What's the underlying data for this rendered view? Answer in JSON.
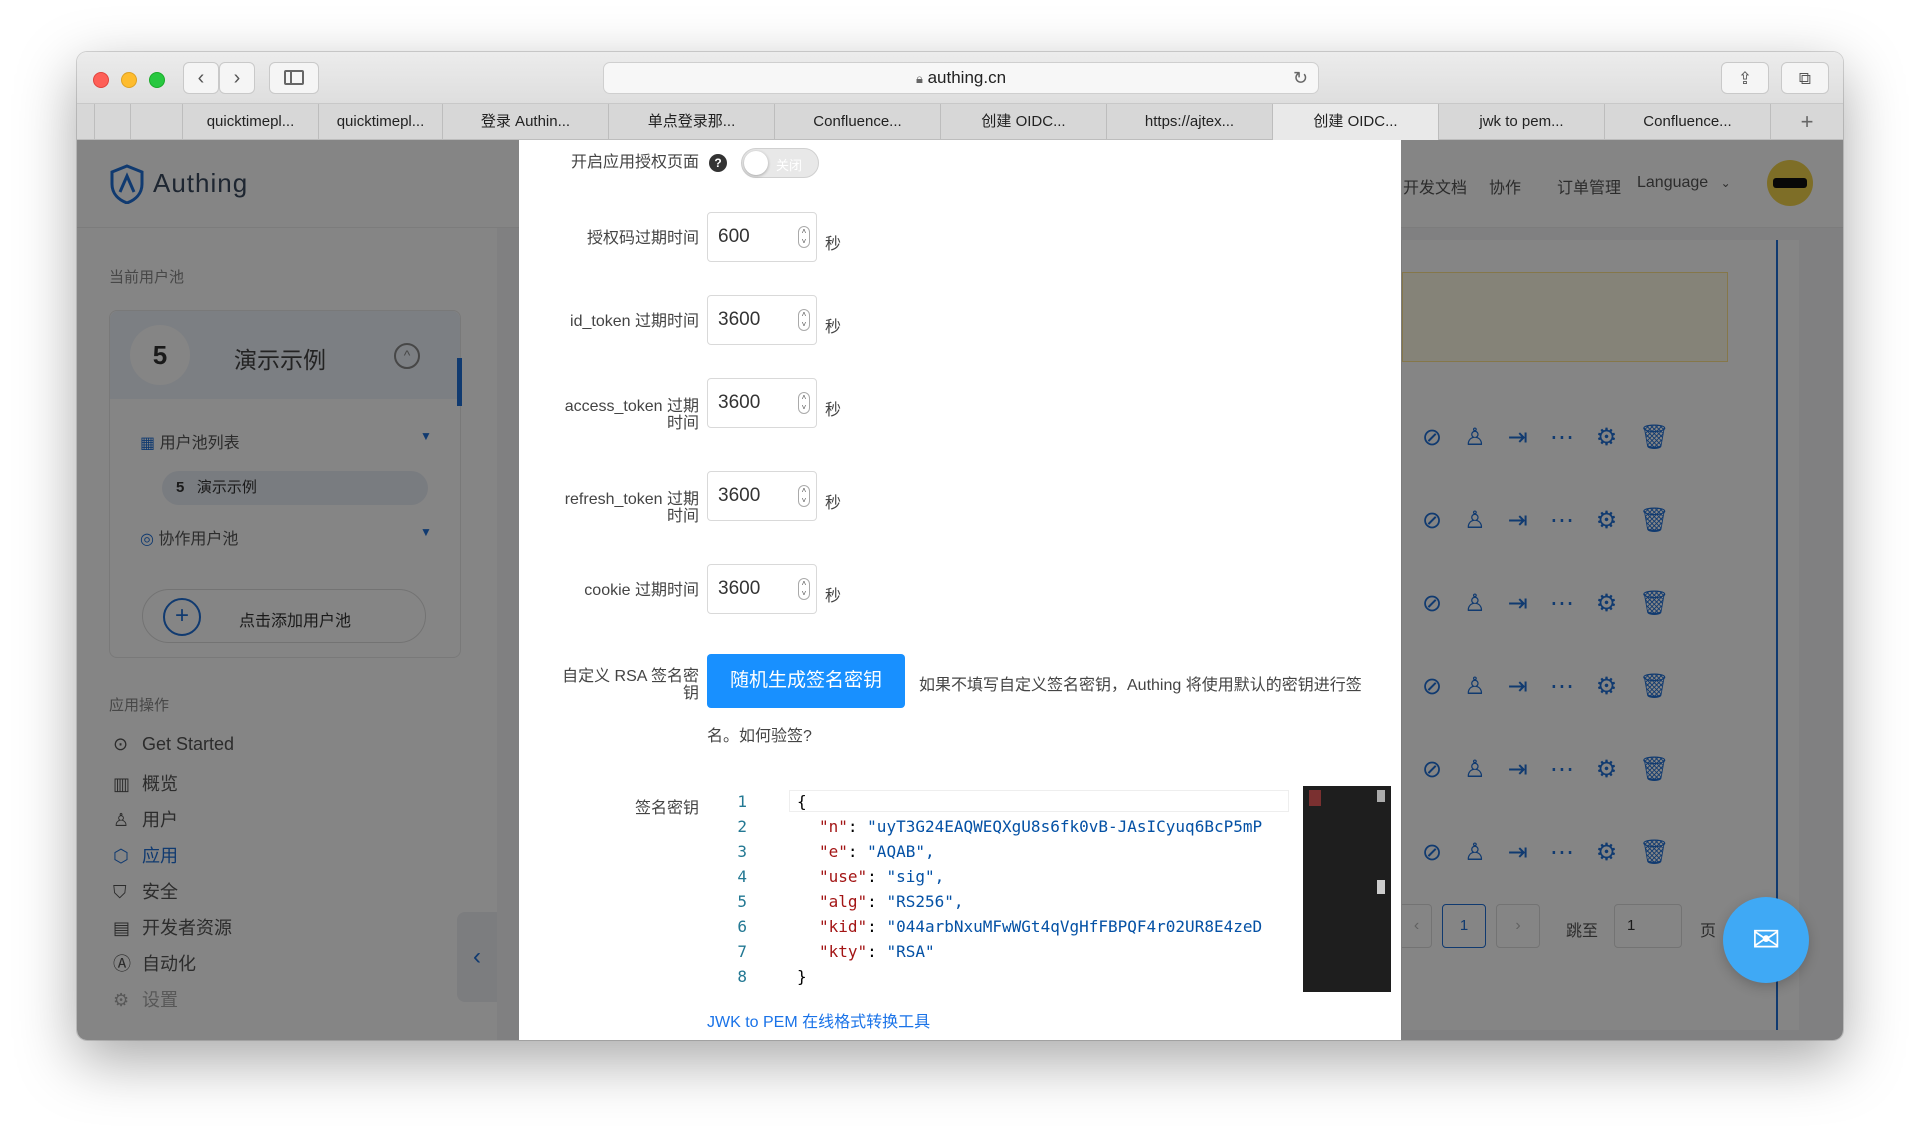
{
  "browser": {
    "url": "authing.cn",
    "tabs": [
      "",
      "",
      "quicktimepl...",
      "quicktimepl...",
      "登录 Authin...",
      "单点登录那...",
      "Confluence...",
      "创建 OIDC...",
      "https://ajtex...",
      "创建 OIDC...",
      "jwk to pem...",
      "Confluence..."
    ],
    "active_tab_index": 9,
    "new_tab": "+"
  },
  "header": {
    "brand": "Authing",
    "nav": [
      "开发文档",
      "协作",
      "订单管理",
      "Language"
    ]
  },
  "sidebar": {
    "pool_section": "当前用户池",
    "pool_name": "演示示例",
    "pool_list": "用户池列表",
    "pool_item": "演示示例",
    "collab_pool": "协作用户池",
    "add_pool": "点击添加用户池",
    "ops_section": "应用操作",
    "menu": [
      {
        "label": "Get Started",
        "icon": "play-circle-icon"
      },
      {
        "label": "概览",
        "icon": "bar-chart-icon"
      },
      {
        "label": "用户",
        "icon": "user-icon"
      },
      {
        "label": "应用",
        "icon": "cube-icon"
      },
      {
        "label": "安全",
        "icon": "shield-icon"
      },
      {
        "label": "开发者资源",
        "icon": "document-icon"
      },
      {
        "label": "自动化",
        "icon": "automation-icon"
      },
      {
        "label": "设置",
        "icon": "gear-icon"
      }
    ],
    "active_menu": "应用"
  },
  "pagination": {
    "current": "1",
    "jump_label": "跳至",
    "jump_value": "1",
    "page_suffix": "页"
  },
  "modal": {
    "consent_label": "开启应用授权页面",
    "consent_toggle": "关闭",
    "fields": [
      {
        "label": "授权码过期时间",
        "value": "600",
        "unit": "秒"
      },
      {
        "label": "id_token 过期时间",
        "value": "3600",
        "unit": "秒"
      },
      {
        "label_line1": "access_token 过期",
        "label_line2": "时间",
        "value": "3600",
        "unit": "秒"
      },
      {
        "label_line1": "refresh_token 过期",
        "label_line2": "时间",
        "value": "3600",
        "unit": "秒"
      },
      {
        "label": "cookie 过期时间",
        "value": "3600",
        "unit": "秒"
      }
    ],
    "rsa_label_line1": "自定义 RSA 签名密",
    "rsa_label_line2": "钥",
    "generate_button": "随机生成签名密钥",
    "rsa_hint_line1": "如果不填写自定义签名密钥，Authing 将使用默认的密钥进行签",
    "rsa_hint_line2": "名。如何验签?",
    "key_label": "签名密钥",
    "code_lines": [
      {
        "num": "1",
        "key": "",
        "value": "",
        "raw": "{"
      },
      {
        "num": "2",
        "key": "\"n\"",
        "value": "\"uyT3G24EAQWEQXgU8s6fk0vB-JAsICyuq6BcP5mP"
      },
      {
        "num": "3",
        "key": "\"e\"",
        "value": "\"AQAB\","
      },
      {
        "num": "4",
        "key": "\"use\"",
        "value": "\"sig\","
      },
      {
        "num": "5",
        "key": "\"alg\"",
        "value": "\"RS256\","
      },
      {
        "num": "6",
        "key": "\"kid\"",
        "value": "\"044arbNxuMFwWGt4qVgHfFBPQF4r02UR8E4zeD"
      },
      {
        "num": "7",
        "key": "\"kty\"",
        "value": "\"RSA\""
      },
      {
        "num": "8",
        "key": "",
        "value": "",
        "raw": "}"
      }
    ],
    "jwk_link": "JWK to PEM 在线格式转换工具"
  },
  "colors": {
    "primary": "#1890ff",
    "link": "#1a73e8",
    "fab": "#3fa9f5"
  }
}
